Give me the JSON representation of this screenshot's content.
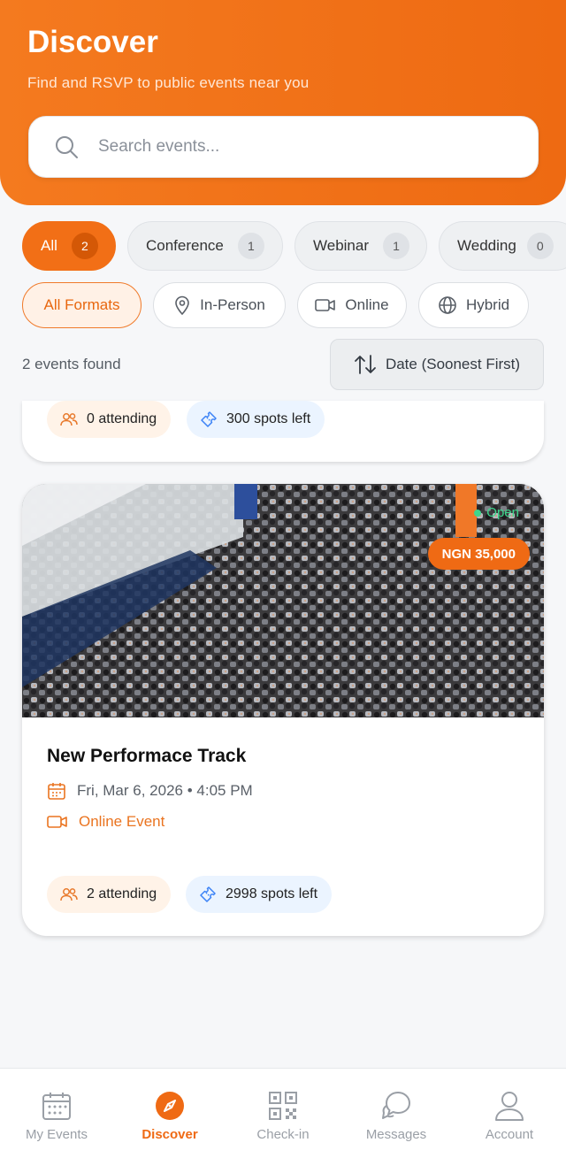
{
  "header": {
    "title": "Discover",
    "subtitle": "Find and RSVP to public events near you"
  },
  "search": {
    "placeholder": "Search events..."
  },
  "categories": [
    {
      "label": "All",
      "count": "2",
      "active": true
    },
    {
      "label": "Conference",
      "count": "1"
    },
    {
      "label": "Webinar",
      "count": "1"
    },
    {
      "label": "Wedding",
      "count": "0"
    }
  ],
  "formats": [
    {
      "label": "All Formats",
      "active": true
    },
    {
      "label": "In-Person",
      "icon": "map-pin-icon"
    },
    {
      "label": "Online",
      "icon": "video-icon"
    },
    {
      "label": "Hybrid",
      "icon": "globe-icon"
    }
  ],
  "results": {
    "count_text": "2 events found",
    "sort_label": "Date (Soonest First)"
  },
  "events": [
    {
      "attending": "0 attending",
      "spots": "300 spots left"
    },
    {
      "title": "New Performace Track",
      "price": "NGN 35,000",
      "status": "Open",
      "date": "Fri, Mar 6, 2026 • 4:05 PM",
      "format": "Online Event",
      "attending": "2 attending",
      "spots": "2998 spots left"
    }
  ],
  "nav": [
    {
      "label": "My Events",
      "icon": "calendar-icon"
    },
    {
      "label": "Discover",
      "icon": "compass-icon",
      "active": true
    },
    {
      "label": "Check-in",
      "icon": "qr-code-icon"
    },
    {
      "label": "Messages",
      "icon": "chat-icon"
    },
    {
      "label": "Account",
      "icon": "user-icon"
    }
  ],
  "colors": {
    "brand": "#f26f16",
    "brand_light": "#fff1e6",
    "info_light": "#ebf4ff",
    "status_open": "#3dd68c"
  }
}
